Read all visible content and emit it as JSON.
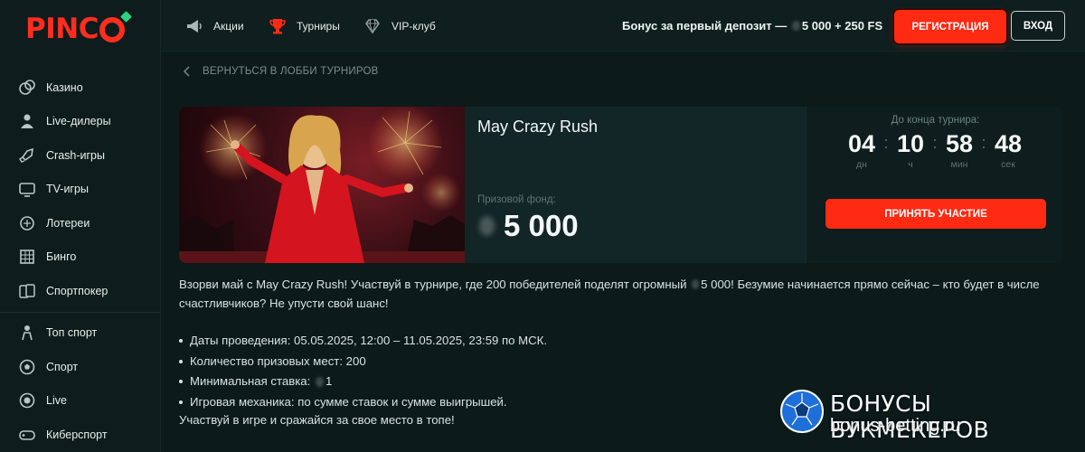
{
  "brand": {
    "logo": "PINCO"
  },
  "sidebar": {
    "items": [
      {
        "label": "Казино",
        "icon": "poker-chips-icon"
      },
      {
        "label": "Live-дилеры",
        "icon": "dealer-icon"
      },
      {
        "label": "Crash-игры",
        "icon": "rocket-icon"
      },
      {
        "label": "TV-игры",
        "icon": "tv-icon"
      },
      {
        "label": "Лотереи",
        "icon": "lottery-ball-icon"
      },
      {
        "label": "Бинго",
        "icon": "bingo-card-icon"
      },
      {
        "label": "Спортпокер",
        "icon": "cards-icon"
      },
      {
        "label": "Топ спорт",
        "icon": "trophy-person-icon"
      },
      {
        "label": "Спорт",
        "icon": "soccer-ball-icon"
      },
      {
        "label": "Live",
        "icon": "live-circle-icon"
      },
      {
        "label": "Киберспорт",
        "icon": "gamepad-icon"
      }
    ]
  },
  "header": {
    "links": [
      {
        "label": "Акции",
        "icon": "megaphone-icon"
      },
      {
        "label": "Турниры",
        "icon": "trophy-icon"
      },
      {
        "label": "VIP-клуб",
        "icon": "diamond-icon"
      }
    ],
    "bonus_prefix": "Бонус за первый депозит —",
    "bonus_amount": "5 000 + 250 FS",
    "register_label": "РЕГИСТРАЦИЯ",
    "login_label": "ВХОД"
  },
  "back_link": "ВЕРНУТЬСЯ В ЛОББИ ТУРНИРОВ",
  "tournament": {
    "title": "May Crazy Rush",
    "prize_label": "Призовой фонд:",
    "prize_value": "5 000",
    "timer_label": "До конца турнира:",
    "timer": {
      "days": "04",
      "days_unit": "дн",
      "hours": "10",
      "hours_unit": "ч",
      "minutes": "58",
      "minutes_unit": "мин",
      "seconds": "48",
      "seconds_unit": "сек"
    },
    "join_label": "ПРИНЯТЬ УЧАСТИЕ"
  },
  "description": {
    "intro_part1": "Взорви май с May Crazy Rush! Участвуй в турнире, где 200 победителей поделят огромный",
    "intro_part2": "5 000! Безумие начинается прямо сейчас – кто будет в числе счастливчиков? Не упусти свой шанс!",
    "bullets": [
      "Даты проведения: 05.05.2025, 12:00 – 11.05.2025, 23:59 по МСК.",
      "Количество призовых мест: 200",
      "Минимальная ставка:",
      "Игровая механика: по сумме ставок и сумме выигрышей."
    ],
    "min_bet_value": "1",
    "closing": "Участвуй в игре и сражайся за свое место в топе!"
  },
  "watermark": {
    "line1": "БОНУСЫ БУКМЕКЕРОВ",
    "line2": "bonus-betting.ru"
  },
  "colors": {
    "accent": "#ff2a12",
    "background": "#0c1a1a",
    "card": "#132627",
    "logo": "#ff2d1e"
  }
}
